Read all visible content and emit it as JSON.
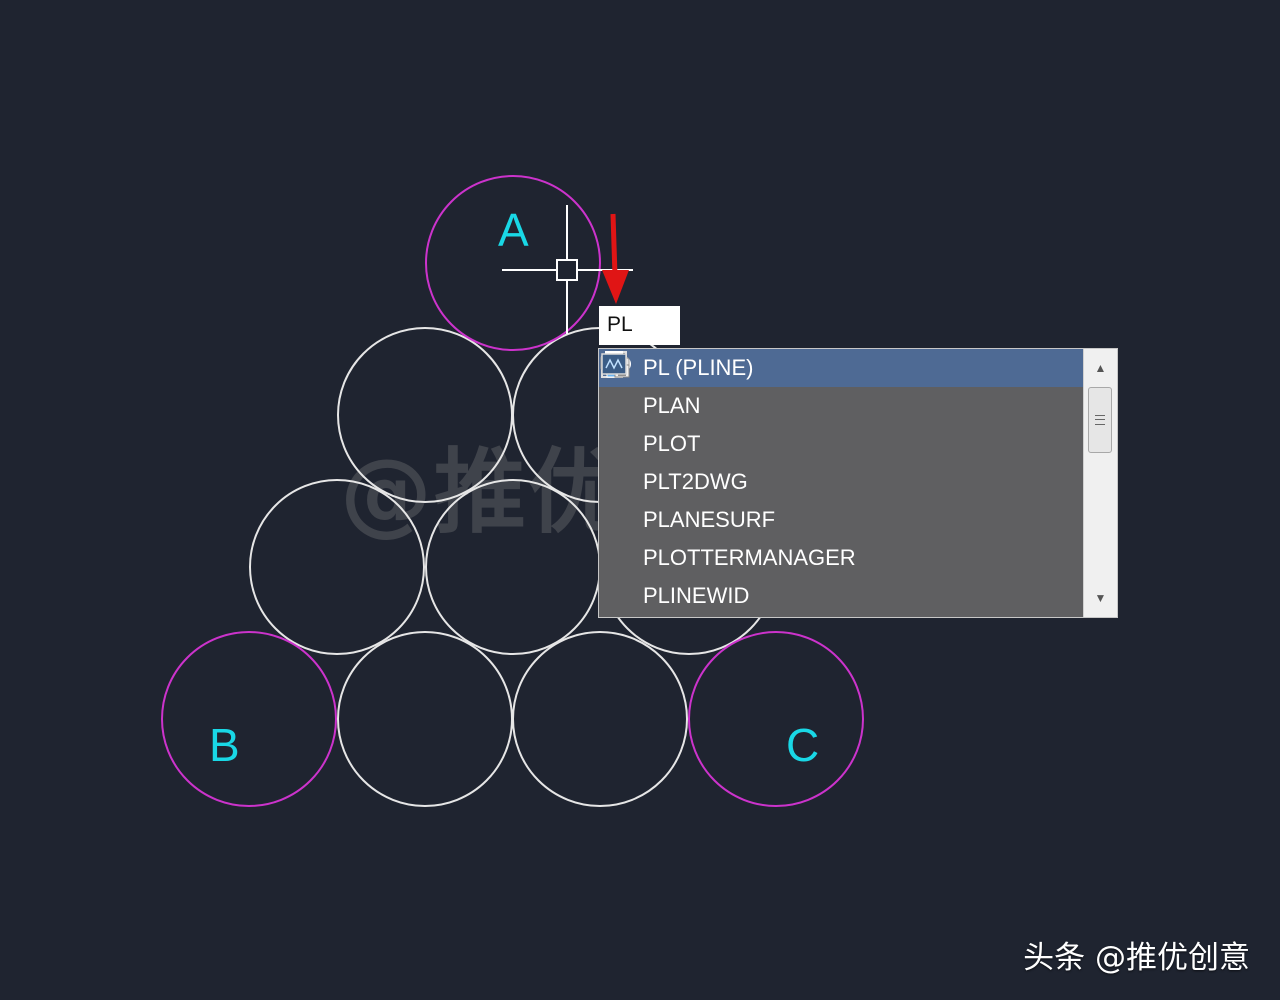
{
  "drawing": {
    "labels": {
      "a": "A",
      "b": "B",
      "c": "C"
    },
    "colors": {
      "background": "#1f2430",
      "circle_default": "#e6e6e6",
      "circle_highlight": "#cc33cc",
      "label": "#19d8e6",
      "arrow": "#e01515"
    },
    "watermark": "@推优创意"
  },
  "command_line": {
    "input_value": "PL"
  },
  "autocomplete": {
    "items": [
      {
        "label": "PL (PLINE)",
        "icon": "polyline-icon",
        "selected": true
      },
      {
        "label": "PLAN",
        "icon": "plan-view-icon",
        "selected": false
      },
      {
        "label": "PLOT",
        "icon": "printer-icon",
        "selected": false
      },
      {
        "label": "PLT2DWG",
        "icon": "",
        "selected": false
      },
      {
        "label": "PLANESURF",
        "icon": "planar-surface-icon",
        "selected": false
      },
      {
        "label": "PLOTTERMANAGER",
        "icon": "plotter-manager-icon",
        "selected": false
      },
      {
        "label": "PLINEWID",
        "icon": "pline-width-icon",
        "selected": false
      }
    ],
    "scrollbar": {
      "up_icon": "scroll-up-arrow-icon",
      "down_icon": "scroll-down-arrow-icon"
    }
  },
  "credit": "头条 @推优创意"
}
